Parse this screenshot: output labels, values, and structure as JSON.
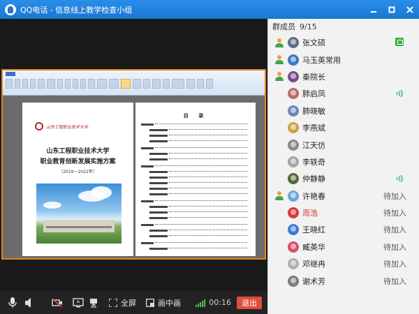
{
  "window": {
    "title": "QQ电话 - 信息线上教学检查小组",
    "controls": [
      "minimize",
      "maximize",
      "close"
    ]
  },
  "toolbar": {
    "fullscreen_label": "全屏",
    "pip_label": "画中画",
    "timer": "00:16",
    "exit_label": "退出"
  },
  "document": {
    "school_logo_text": "山东工程职业技术大学",
    "title_line1": "山东工程职业技术大学",
    "title_line2": "职业教育创新发展实施方案",
    "year": "（2019－2022年）",
    "toc_title": "目 录"
  },
  "members": {
    "label": "群成员",
    "count": "9/15",
    "list": [
      {
        "name": "张文硕",
        "host": true,
        "status": "",
        "speaking": false,
        "sharing": true,
        "avatar_color": "#5b6f86"
      },
      {
        "name": "马玉英常用",
        "host": true,
        "status": "",
        "speaking": false,
        "sharing": false,
        "avatar_color": "#3d79c2"
      },
      {
        "name": "秦院长",
        "host": true,
        "status": "",
        "speaking": false,
        "sharing": false,
        "avatar_color": "#7a4b8f"
      },
      {
        "name": "肺启凤",
        "host": false,
        "status": "",
        "speaking": true,
        "sharing": false,
        "avatar_color": "#b86e6e"
      },
      {
        "name": "肺晓敏",
        "host": false,
        "status": "",
        "speaking": false,
        "sharing": false,
        "avatar_color": "#6e86b8"
      },
      {
        "name": "李燕斌",
        "host": false,
        "status": "",
        "speaking": false,
        "sharing": false,
        "avatar_color": "#c9a24a"
      },
      {
        "name": "江天仿",
        "host": false,
        "status": "",
        "speaking": false,
        "sharing": false,
        "avatar_color": "#8a8a8a"
      },
      {
        "name": "李轶奇",
        "host": false,
        "status": "",
        "speaking": false,
        "sharing": false,
        "avatar_color": "#a5a5a5"
      },
      {
        "name": "仲静静",
        "host": false,
        "status": "",
        "speaking": true,
        "sharing": false,
        "avatar_color": "#4f6b3a"
      },
      {
        "name": "许艳春",
        "host": true,
        "status": "待加入",
        "speaking": false,
        "sharing": false,
        "avatar_color": "#6ea7d6"
      },
      {
        "name": "周浩",
        "host": false,
        "status": "待加入",
        "speaking": false,
        "sharing": false,
        "avatar_color": "#d63a3a",
        "highlight": true
      },
      {
        "name": "王晓红",
        "host": false,
        "status": "待加入",
        "speaking": false,
        "sharing": false,
        "avatar_color": "#3a7bd6"
      },
      {
        "name": "臧英华",
        "host": false,
        "status": "待加入",
        "speaking": false,
        "sharing": false,
        "avatar_color": "#d64f6a"
      },
      {
        "name": "邓继冉",
        "host": false,
        "status": "待加入",
        "speaking": false,
        "sharing": false,
        "avatar_color": "#b0b0b0"
      },
      {
        "name": "谢术芳",
        "host": false,
        "status": "待加入",
        "speaking": false,
        "sharing": false,
        "avatar_color": "#7c7c7c"
      }
    ]
  },
  "colors": {
    "titlebar": "#1977d3",
    "share_border": "#e8841e",
    "exit": "#e04b3d",
    "speaking": "#35b145",
    "highlight_name": "#e0312b"
  }
}
